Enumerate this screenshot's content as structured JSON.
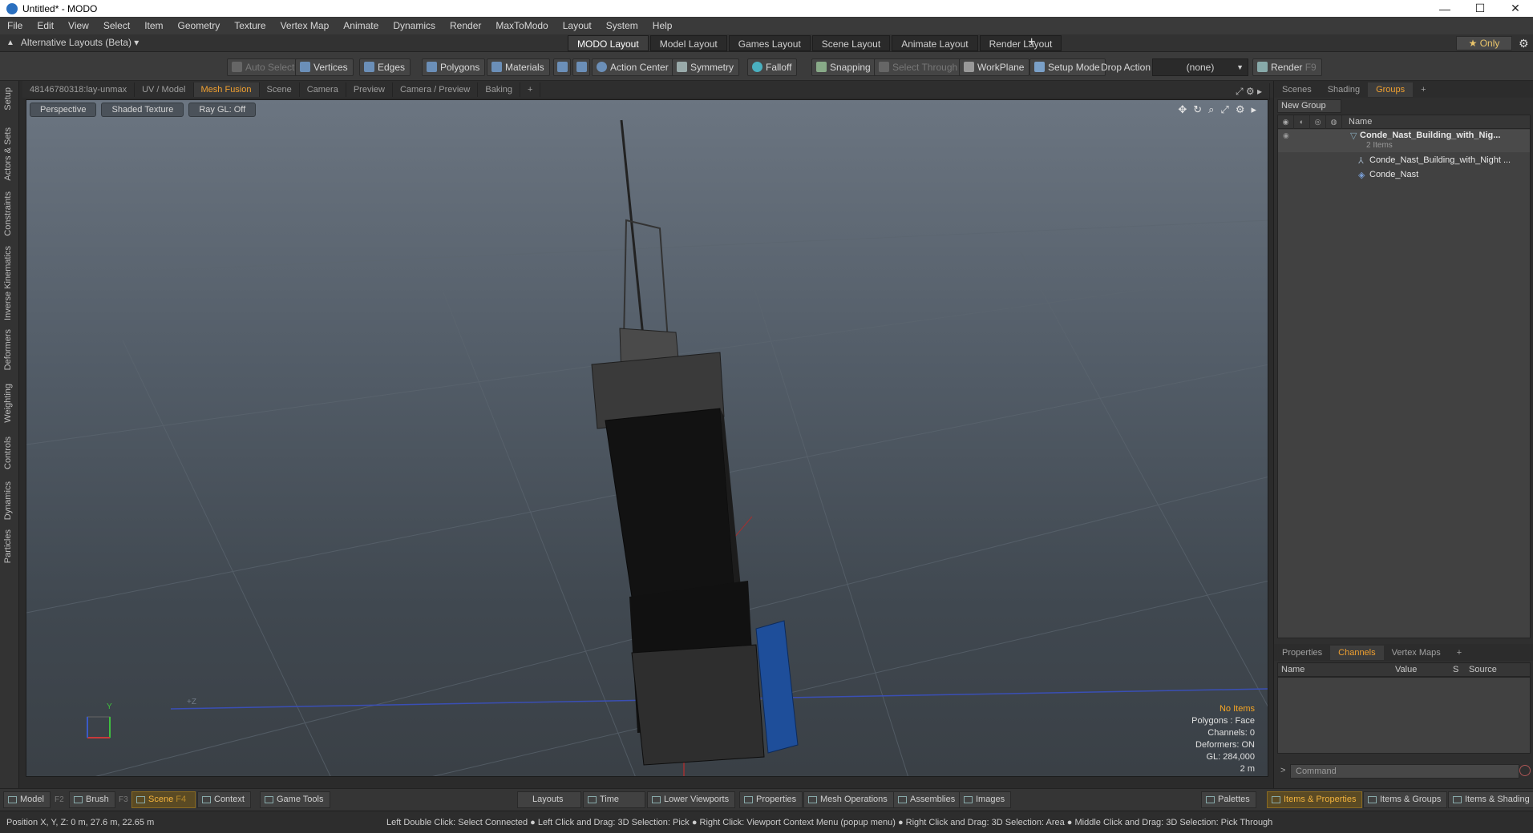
{
  "window": {
    "title": "Untitled* - MODO",
    "buttons": [
      "—",
      "☐",
      "✕"
    ]
  },
  "menu": [
    "File",
    "Edit",
    "View",
    "Select",
    "Item",
    "Geometry",
    "Texture",
    "Vertex Map",
    "Animate",
    "Dynamics",
    "Render",
    "MaxToModo",
    "Layout",
    "System",
    "Help"
  ],
  "layout_bar": {
    "alt_layouts": "Alternative Layouts (Beta) ▾",
    "tabs": [
      "MODO Layout",
      "Model Layout",
      "Games Layout",
      "Scene Layout",
      "Animate Layout",
      "Render Layout"
    ],
    "plus": "+",
    "only": "★  Only"
  },
  "toolbar": {
    "auto_select": "Auto Select",
    "vertices": "Vertices",
    "edges": "Edges",
    "polygons": "Polygons",
    "materials": "Materials",
    "action_center": "Action Center",
    "symmetry": "Symmetry",
    "falloff": "Falloff",
    "snapping": "Snapping",
    "select_through": "Select Through",
    "workplane": "WorkPlane",
    "setup_mode": "Setup Mode",
    "drop_action": "Drop Action",
    "drop_value": "(none)",
    "render": "Render",
    "render_key": "F9"
  },
  "left_tabs": [
    "Setup",
    "Actors & Sets",
    "Constraints",
    "Inverse Kinematics",
    "Deformers",
    "Weighting",
    "Controls",
    "Dynamics",
    "Particles"
  ],
  "viewport_tabs": [
    "48146780318:lay-unmax",
    "UV / Model",
    "Mesh Fusion",
    "Scene",
    "Camera",
    "Preview",
    "Camera / Preview",
    "Baking",
    "+"
  ],
  "viewport_tabs_active": "Mesh Fusion",
  "viewport": {
    "mode_buttons": [
      "Perspective",
      "Shaded Texture",
      "Ray GL: Off"
    ],
    "info": {
      "items": "No Items",
      "polygons": "Polygons : Face",
      "channels": "Channels: 0",
      "deformers": "Deformers: ON",
      "gl": "GL: 284,000",
      "scale": "2 m"
    },
    "axis_label_y": "Y",
    "axis_label_z": "+Z"
  },
  "right_panel": {
    "top_tabs": [
      "Scenes",
      "Shading",
      "Groups",
      "+"
    ],
    "top_active": "Groups",
    "new_group": "New Group",
    "list_header_name": "Name",
    "items": [
      {
        "name": "Conde_Nast_Building_with_Nig...",
        "sub": "2 Items"
      },
      {
        "name": "Conde_Nast_Building_with_Night ..."
      },
      {
        "name": "Conde_Nast"
      }
    ],
    "bottom_tabs": [
      "Properties",
      "Channels",
      "Vertex Maps",
      "+"
    ],
    "bottom_active": "Channels",
    "channel_cols": [
      "Name",
      "Value",
      "S",
      "Source"
    ],
    "command_placeholder": "Command",
    "command_prompt": ">"
  },
  "bottom_bar": {
    "left": [
      {
        "label": "Model",
        "key": "F2"
      },
      {
        "label": "Brush",
        "key": "F3"
      },
      {
        "label": "Scene",
        "key": "F4"
      },
      {
        "label": "Context",
        "key": ""
      },
      {
        "label": "Game Tools",
        "key": ""
      }
    ],
    "middle": [
      "Layouts",
      "Time",
      "Lower Viewports",
      "Properties",
      "Mesh Operations",
      "Assemblies",
      "Images"
    ],
    "right": [
      "Palettes",
      "Items & Properties",
      "Items & Groups",
      "Items & Shading"
    ]
  },
  "status": {
    "position": "Position X, Y, Z:   0 m, 27.6 m, 22.65 m",
    "hint": "Left Double Click: Select Connected ● Left Click and Drag: 3D Selection: Pick ● Right Click: Viewport Context Menu (popup menu) ● Right Click and Drag: 3D Selection: Area ● Middle Click and Drag: 3D Selection: Pick Through"
  },
  "colors": {
    "accent": "#f0a030",
    "viewport_top": "#6b7581",
    "viewport_bottom": "#3a4046"
  }
}
